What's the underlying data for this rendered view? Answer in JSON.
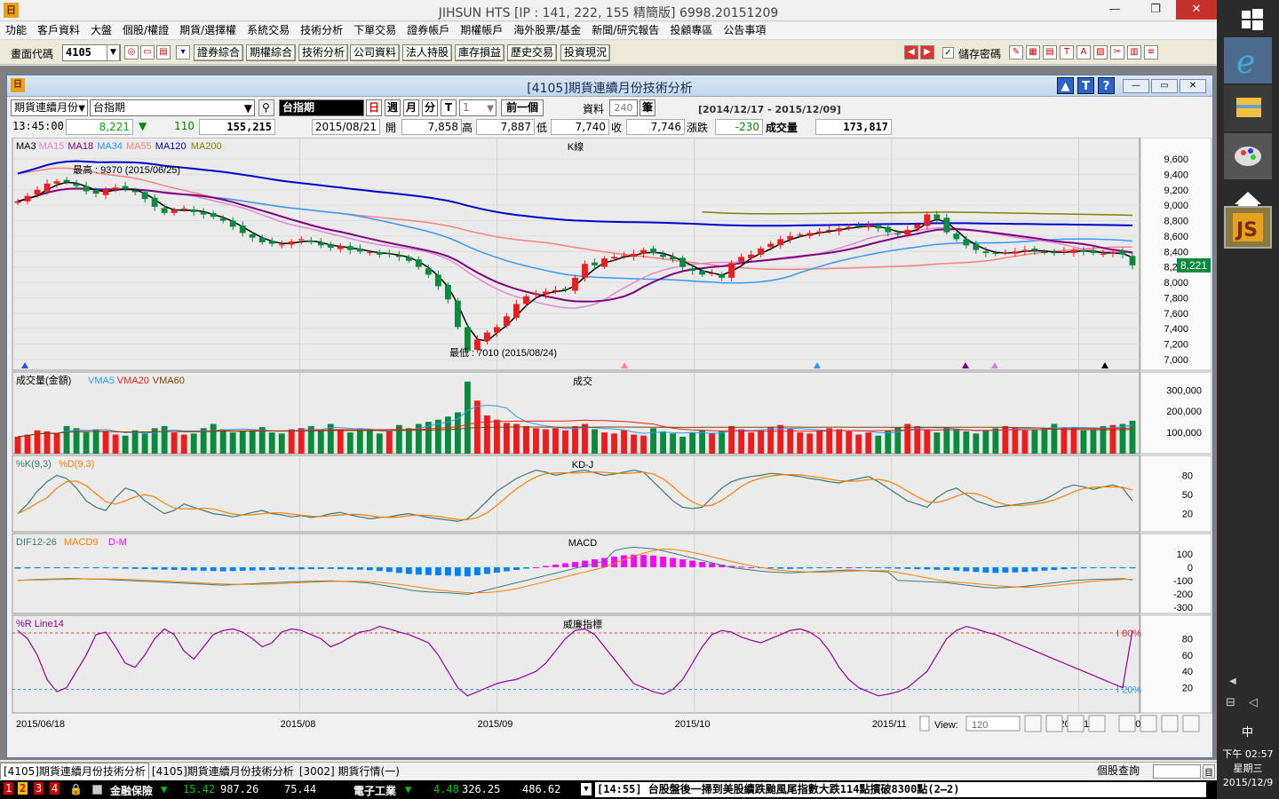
{
  "window": {
    "title": "JIHSUN HTS    [IP : 141, 222, 155 精簡版] 6998.20151209",
    "logo": "日",
    "min": "—",
    "restore": "❐",
    "close": "✕"
  },
  "menu": [
    "功能",
    "客戶資料",
    "大盤",
    "個股/權證",
    "期貨/選擇權",
    "系統交易",
    "技術分析",
    "下單交易",
    "證券帳戶",
    "期權帳戶",
    "海外股票/基金",
    "新聞/研究報告",
    "投顧專區",
    "公告事項"
  ],
  "toolbar": {
    "code_label": "畫面代碼",
    "code_value": "4105",
    "nav_buttons": [
      "證券綜合",
      "期權綜合",
      "技術分析",
      "公司資料",
      "法人持股",
      "庫存損益",
      "歷史交易",
      "投資現況"
    ],
    "save_password_label": "儲存密碼",
    "save_password_checked": true
  },
  "child_window": {
    "title": "[4105]期貨連續月份技術分析",
    "help_buttons": [
      "▲",
      "T",
      "?"
    ]
  },
  "controls": {
    "product_type": "期貨連續月份",
    "product": "台指期",
    "instrument_name": "台指期",
    "period_day": "日",
    "period_week": "週",
    "period_month": "月",
    "period_min": "分",
    "period_tick": "T",
    "interval": "1",
    "prev_button": "前一個",
    "data_label": "資料",
    "data_count": "240",
    "data_unit": "筆",
    "date_range": "[2014/12/17 - 2015/12/09]"
  },
  "quote": {
    "time": "13:45:00",
    "price": "8,221",
    "arrow": "▼",
    "change": "110",
    "volume_total": "155,215",
    "date": "2015/08/21",
    "open_label": "開",
    "open": "7,858",
    "high_label": "高",
    "high": "7,887",
    "low_label": "低",
    "low": "7,740",
    "close_label": "收",
    "close": "7,746",
    "chg_label": "漲跌",
    "chg": "-230",
    "vol_label": "成交量",
    "vol": "173,817"
  },
  "colors": {
    "up": "#ee1c1c",
    "down": "#0a8a3c",
    "ma3": "#000000",
    "ma15": "#e28ad0",
    "ma18": "#800080",
    "ma34": "#3399ff",
    "ma55": "#ff8080",
    "ma120": "#0000cc",
    "ma200": "#808000",
    "k": "#3a7a7a",
    "d": "#ff8000",
    "macd_pos": "#ff00ff",
    "macd_neg": "#0080ff",
    "wr": "#990099"
  },
  "panels": {
    "kline": {
      "title": "K線",
      "legend": [
        "MA3",
        "MA15",
        "MA18",
        "MA34",
        "MA55",
        "MA120",
        "MA200"
      ],
      "y_ticks": [
        "9,600",
        "9,400",
        "9,200",
        "9,000",
        "8,800",
        "8,600",
        "8,400",
        "8,200",
        "8,000",
        "7,800",
        "7,600",
        "7,400",
        "7,200",
        "7,000"
      ],
      "high_note": "最高 : 9370 (2015/06/25)",
      "low_note": "最低 : 7010 (2015/08/24)",
      "last_price": "8,221"
    },
    "volume": {
      "title": "成交",
      "legend": [
        "成交量(金額)",
        "VMA5",
        "VMA20",
        "VMA60"
      ],
      "y_ticks": [
        "300,000",
        "200,000",
        "100,000"
      ]
    },
    "kd": {
      "title": "KD-J",
      "legend": [
        "%K(9,3)",
        "%D(9,3)"
      ],
      "y_ticks": [
        "80",
        "50",
        "20"
      ]
    },
    "macd": {
      "title": "MACD",
      "legend": [
        "DIF12-26",
        "MACD9",
        "D-M"
      ],
      "y_ticks": [
        "100",
        "0",
        "-100",
        "-200",
        "-300"
      ]
    },
    "wr": {
      "title": "威廉指標",
      "legend": [
        "%R Line14"
      ],
      "y_ticks": [
        "80",
        "60",
        "40",
        "20"
      ],
      "upper_label": "80%",
      "lower_label": "20%"
    },
    "x_ticks": [
      "2015/06/18",
      "2015/08",
      "2015/09",
      "2015/10",
      "2015/11",
      "2015/12",
      "12/09"
    ]
  },
  "chart_data": {
    "type": "candlestick",
    "title": "台指期",
    "x_range": [
      "2015/06/18",
      "2015/12/09"
    ],
    "ylim": [
      7000,
      9600
    ],
    "close_series": [
      9050,
      9120,
      9200,
      9280,
      9310,
      9300,
      9250,
      9180,
      9150,
      9200,
      9230,
      9210,
      9170,
      9080,
      8980,
      8900,
      8940,
      8960,
      8910,
      8880,
      8850,
      8800,
      8720,
      8640,
      8580,
      8520,
      8500,
      8490,
      8530,
      8560,
      8520,
      8480,
      8450,
      8470,
      8420,
      8400,
      8390,
      8360,
      8370,
      8330,
      8280,
      8200,
      8100,
      7950,
      7780,
      7420,
      7110,
      7260,
      7350,
      7420,
      7560,
      7720,
      7820,
      7860,
      7880,
      7900,
      7910,
      8060,
      8240,
      8220,
      8310,
      8330,
      8350,
      8370,
      8420,
      8380,
      8330,
      8300,
      8200,
      8150,
      8100,
      8120,
      8060,
      8250,
      8330,
      8360,
      8440,
      8500,
      8560,
      8600,
      8620,
      8640,
      8660,
      8680,
      8700,
      8720,
      8730,
      8740,
      8700,
      8650,
      8620,
      8680,
      8750,
      8880,
      8820,
      8650,
      8560,
      8480,
      8420,
      8380,
      8370,
      8390,
      8400,
      8420,
      8410,
      8390,
      8380,
      8400,
      8420,
      8400,
      8380,
      8370,
      8390,
      8360,
      8221
    ],
    "volume_series": [
      80,
      90,
      110,
      105,
      95,
      130,
      120,
      100,
      115,
      105,
      90,
      85,
      110,
      95,
      120,
      130,
      100,
      90,
      95,
      120,
      140,
      115,
      100,
      105,
      110,
      125,
      100,
      95,
      115,
      120,
      130,
      110,
      140,
      115,
      100,
      120,
      110,
      95,
      105,
      135,
      120,
      140,
      150,
      160,
      175,
      195,
      340,
      250,
      180,
      160,
      145,
      140,
      130,
      120,
      115,
      120,
      110,
      130,
      140,
      115,
      100,
      95,
      110,
      90,
      85,
      120,
      105,
      95,
      80,
      100,
      110,
      95,
      105,
      130,
      115,
      100,
      110,
      125,
      135,
      120,
      100,
      95,
      110,
      120,
      115,
      105,
      90,
      100,
      85,
      110,
      125,
      140,
      130,
      115,
      100,
      125,
      115,
      105,
      95,
      110,
      120,
      130,
      125,
      110,
      115,
      120,
      140,
      125,
      120,
      110,
      115,
      130,
      135,
      140,
      155
    ],
    "kd_k": [
      20,
      35,
      55,
      70,
      80,
      75,
      60,
      40,
      30,
      25,
      45,
      60,
      55,
      40,
      30,
      20,
      25,
      35,
      30,
      25,
      20,
      18,
      15,
      18,
      22,
      25,
      20,
      18,
      15,
      17,
      14,
      16,
      20,
      22,
      18,
      15,
      12,
      14,
      15,
      18,
      20,
      17,
      14,
      12,
      10,
      8,
      12,
      25,
      40,
      55,
      65,
      75,
      82,
      88,
      85,
      80,
      83,
      86,
      88,
      84,
      80,
      82,
      85,
      88,
      85,
      70,
      55,
      40,
      30,
      28,
      30,
      45,
      60,
      70,
      75,
      78,
      80,
      83,
      82,
      80,
      78,
      75,
      73,
      70,
      68,
      72,
      75,
      78,
      70,
      60,
      50,
      40,
      35,
      30,
      45,
      55,
      60,
      50,
      40,
      35,
      30,
      32,
      34,
      36,
      38,
      42,
      50,
      60,
      65,
      62,
      58,
      62,
      65,
      60,
      40
    ],
    "wr": [
      90,
      80,
      60,
      30,
      15,
      20,
      40,
      60,
      85,
      88,
      70,
      50,
      45,
      60,
      80,
      92,
      85,
      65,
      55,
      70,
      85,
      90,
      92,
      88,
      80,
      70,
      75,
      88,
      92,
      90,
      85,
      80,
      70,
      75,
      82,
      88,
      90,
      95,
      92,
      88,
      85,
      80,
      75,
      60,
      40,
      20,
      10,
      15,
      20,
      25,
      28,
      30,
      35,
      40,
      50,
      65,
      80,
      90,
      92,
      85,
      70,
      55,
      40,
      25,
      20,
      15,
      12,
      18,
      30,
      50,
      70,
      85,
      90,
      88,
      82,
      78,
      75,
      80,
      85,
      90,
      92,
      88,
      80,
      65,
      45,
      30,
      20,
      15,
      10,
      12,
      15,
      20,
      30,
      40,
      60,
      80,
      90,
      95,
      92,
      88,
      85,
      80,
      75,
      70,
      65,
      60,
      55,
      50,
      45,
      40,
      35,
      30,
      25,
      20,
      90
    ],
    "macd_hist": [
      -10,
      -8,
      -6,
      -5,
      -4,
      -3,
      -3,
      -4,
      -5,
      -6,
      -8,
      -10,
      -12,
      -14,
      -16,
      -18,
      -20,
      -22,
      -24,
      -26,
      -28,
      -30,
      -28,
      -26,
      -24,
      -22,
      -20,
      -18,
      -16,
      -15,
      -14,
      -13,
      -12,
      -14,
      -16,
      -18,
      -22,
      -28,
      -35,
      -42,
      -50,
      -55,
      -58,
      -60,
      -62,
      -65,
      -68,
      -60,
      -50,
      -40,
      -30,
      -20,
      -10,
      0,
      10,
      20,
      30,
      40,
      50,
      60,
      70,
      80,
      90,
      95,
      92,
      88,
      80,
      70,
      60,
      50,
      40,
      30,
      20,
      10,
      5,
      0,
      -5,
      -8,
      -10,
      -12,
      -10,
      -8,
      -6,
      -4,
      -2,
      0,
      -2,
      -4,
      -6,
      -8,
      -10,
      -12,
      -14,
      -16,
      -18,
      -20,
      -25,
      -30,
      -35,
      -40,
      -42,
      -40,
      -38,
      -35,
      -30,
      -25,
      -20,
      -15,
      -10,
      -8,
      -6,
      -5,
      -4,
      -3,
      -8
    ]
  },
  "bottom_tabs": [
    "[4105]期貨連續月份技術分析",
    "[4105]期貨連續月份技術分析",
    "[3002] 期貨行情(一)"
  ],
  "stock_query_label": "個股查詢",
  "view_label": "View:",
  "view_value": "120",
  "status": {
    "tabs": [
      "1",
      "2",
      "3",
      "4"
    ],
    "item1_name": "金融保險",
    "item1_arrow": "▼",
    "item1_chg": "15.42",
    "item1_val": "987.26",
    "item1_amt": "75.44",
    "item2_name": "電子工業",
    "item2_arrow": "▼",
    "item2_chg": "4.48",
    "item2_val": "326.25",
    "item2_amt": "486.62",
    "news": "[14:55] 台股盤後一掃到美股續跌颱風尾指數大跌114點摜破8300點(2—2)"
  },
  "taskbar": {
    "time": "下午 02:57",
    "weekday": "星期三",
    "date": "2015/12/9",
    "ime": "中"
  }
}
